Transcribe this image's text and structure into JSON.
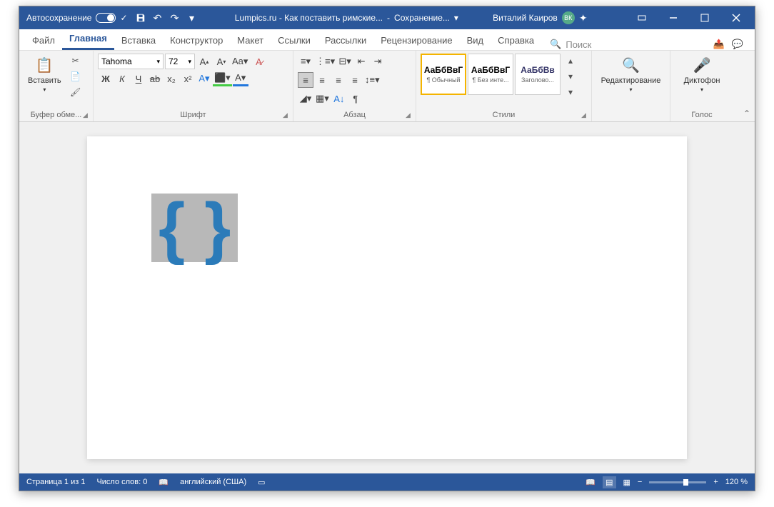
{
  "titlebar": {
    "autosave_label": "Автосохранение",
    "doc_title": "Lumpics.ru - Как поставить римские...",
    "saving": "Сохранение...",
    "user": "Виталий Каиров",
    "user_initials": "ВК"
  },
  "tabs": {
    "file": "Файл",
    "home": "Главная",
    "insert": "Вставка",
    "design": "Конструктор",
    "layout": "Макет",
    "references": "Ссылки",
    "mailings": "Рассылки",
    "review": "Рецензирование",
    "view": "Вид",
    "help": "Справка",
    "search": "Поиск"
  },
  "ribbon": {
    "clipboard": {
      "label": "Буфер обме...",
      "paste": "Вставить"
    },
    "font": {
      "label": "Шрифт",
      "family": "Tahoma",
      "size": "72",
      "bold": "Ж",
      "italic": "К",
      "underline": "Ч",
      "strike": "ab",
      "sub": "x₂",
      "sup": "x²"
    },
    "paragraph": {
      "label": "Абзац"
    },
    "styles": {
      "label": "Стили",
      "items": [
        {
          "preview": "АаБбВвГ",
          "caption": "¶ Обычный"
        },
        {
          "preview": "АаБбВвГ",
          "caption": "¶ Без инте..."
        },
        {
          "preview": "АаБбВв",
          "caption": "Заголово..."
        }
      ]
    },
    "editing": {
      "label": "Редактирование"
    },
    "voice": {
      "label": "Голос",
      "dictate": "Диктофон"
    }
  },
  "document": {
    "content": "{ }"
  },
  "statusbar": {
    "page": "Страница 1 из 1",
    "words": "Число слов: 0",
    "lang": "английский (США)",
    "zoom": "120 %"
  }
}
